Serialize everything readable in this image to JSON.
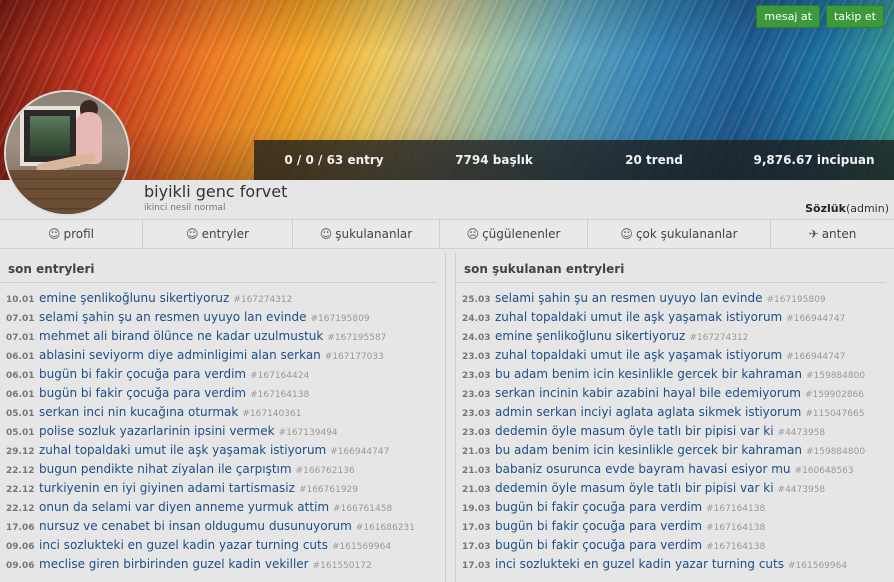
{
  "actions": {
    "message": "mesaj at",
    "follow": "takip et"
  },
  "stats": {
    "entries": "0 / 0 / 63 entry",
    "topics": "7794 başlık",
    "trends": "20 trend",
    "points": "9,876.67 incipuan"
  },
  "user": {
    "name": "biyikli genc forvet",
    "subtitle": "ikinci nesil normal",
    "role_name": "Sözlük",
    "role_tag": "(admin)"
  },
  "tabs": [
    {
      "label": "profil",
      "icon": "smile-icon"
    },
    {
      "label": "entryler",
      "icon": "smile-icon"
    },
    {
      "label": "şukulananlar",
      "icon": "smile-icon"
    },
    {
      "label": "çügülenenler",
      "icon": "frown-icon"
    },
    {
      "label": "çok şukulananlar",
      "icon": "smile-icon"
    },
    {
      "label": "anten",
      "icon": "satellite-icon"
    }
  ],
  "left_column": {
    "heading": "son entryleri",
    "entries": [
      {
        "date": "10.01",
        "title": "emine şenlikoğlunu sikertiyoruz",
        "num": "#167274312"
      },
      {
        "date": "07.01",
        "title": "selami şahin şu an resmen uyuyo lan evinde",
        "num": "#167195809"
      },
      {
        "date": "07.01",
        "title": "mehmet ali birand ölünce ne kadar uzulmustuk",
        "num": "#167195587"
      },
      {
        "date": "06.01",
        "title": "ablasini seviyorm diye adminligimi alan serkan",
        "num": "#167177033"
      },
      {
        "date": "06.01",
        "title": "bugün bi fakir çocuğa para verdim",
        "num": "#167164424"
      },
      {
        "date": "06.01",
        "title": "bugün bi fakir çocuğa para verdim",
        "num": "#167164138"
      },
      {
        "date": "05.01",
        "title": "serkan inci nin kucağına oturmak",
        "num": "#167140361"
      },
      {
        "date": "05.01",
        "title": "polise sozluk yazarlarinin ipsini vermek",
        "num": "#167139494"
      },
      {
        "date": "29.12",
        "title": "zuhal topaldaki umut ile aşk yaşamak istiyorum",
        "num": "#166944747"
      },
      {
        "date": "22.12",
        "title": "bugun pendikte nihat ziyalan ile çarpıştım",
        "num": "#166762136"
      },
      {
        "date": "22.12",
        "title": "turkiyenin en iyi giyinen adami tartismasiz",
        "num": "#166761929"
      },
      {
        "date": "22.12",
        "title": "onun da selami var diyen anneme yurmuk attim",
        "num": "#166761458"
      },
      {
        "date": "17.06",
        "title": "nursuz ve cenabet bi insan oldugumu dusunuyorum",
        "num": "#161686231"
      },
      {
        "date": "09.06",
        "title": "inci sozlukteki en guzel kadin yazar turning cuts",
        "num": "#161569964"
      },
      {
        "date": "09.06",
        "title": "meclise giren birbirinden guzel kadin vekiller",
        "num": "#161550172"
      }
    ]
  },
  "right_column": {
    "heading": "son şukulanan entryleri",
    "entries": [
      {
        "date": "25.03",
        "title": "selami şahin şu an resmen uyuyo lan evinde",
        "num": "#167195809"
      },
      {
        "date": "24.03",
        "title": "zuhal topaldaki umut ile aşk yaşamak istiyorum",
        "num": "#166944747"
      },
      {
        "date": "24.03",
        "title": "emine şenlikoğlunu sikertiyoruz",
        "num": "#167274312"
      },
      {
        "date": "23.03",
        "title": "zuhal topaldaki umut ile aşk yaşamak istiyorum",
        "num": "#166944747"
      },
      {
        "date": "23.03",
        "title": "bu adam benim icin kesinlikle gercek bir kahraman",
        "num": "#159884800"
      },
      {
        "date": "23.03",
        "title": "serkan incinin kabir azabini hayal bile edemiyorum",
        "num": "#159902866"
      },
      {
        "date": "23.03",
        "title": "admin serkan inciyi aglata aglata sikmek istiyorum",
        "num": "#115047665"
      },
      {
        "date": "23.03",
        "title": "dedemin öyle masum öyle tatlı bir pipisi var ki",
        "num": "#4473958"
      },
      {
        "date": "21.03",
        "title": "bu adam benim icin kesinlikle gercek bir kahraman",
        "num": "#159884800"
      },
      {
        "date": "21.03",
        "title": "babaniz osurunca evde bayram havasi esiyor mu",
        "num": "#160648563"
      },
      {
        "date": "21.03",
        "title": "dedemin öyle masum öyle tatlı bir pipisi var ki",
        "num": "#4473958"
      },
      {
        "date": "19.03",
        "title": "bugün bi fakir çocuğa para verdim",
        "num": "#167164138"
      },
      {
        "date": "17.03",
        "title": "bugün bi fakir çocuğa para verdim",
        "num": "#167164138"
      },
      {
        "date": "17.03",
        "title": "bugün bi fakir çocuğa para verdim",
        "num": "#167164138"
      },
      {
        "date": "17.03",
        "title": "inci sozlukteki en guzel kadin yazar turning cuts",
        "num": "#161569964"
      }
    ]
  }
}
